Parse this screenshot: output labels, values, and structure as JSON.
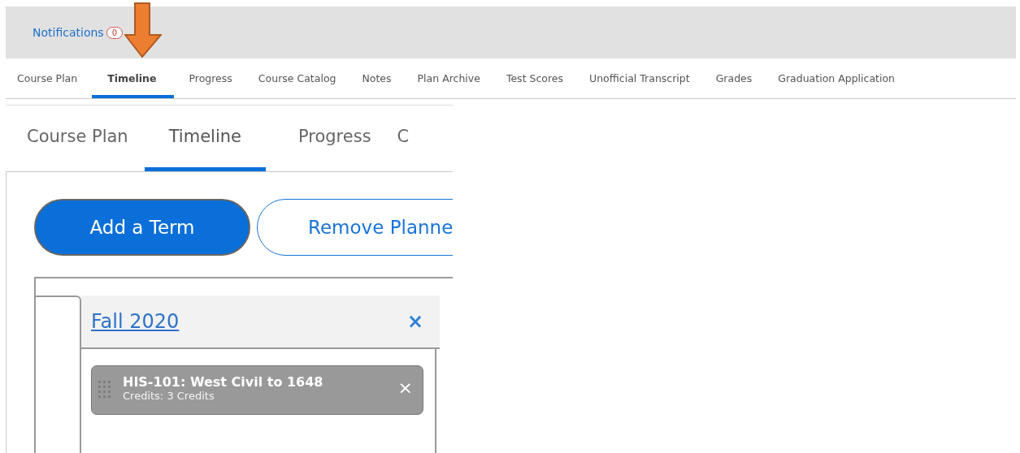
{
  "header": {
    "notifications": {
      "label": "Notifications",
      "count": "0"
    }
  },
  "tabs": [
    {
      "label": "Course Plan",
      "selected": false
    },
    {
      "label": "Timeline",
      "selected": true
    },
    {
      "label": "Progress",
      "selected": false
    },
    {
      "label": "Course Catalog",
      "selected": false
    },
    {
      "label": "Notes",
      "selected": false
    },
    {
      "label": "Plan Archive",
      "selected": false
    },
    {
      "label": "Test Scores",
      "selected": false
    },
    {
      "label": "Unofficial Transcript",
      "selected": false
    },
    {
      "label": "Grades",
      "selected": false
    },
    {
      "label": "Graduation Application",
      "selected": false
    }
  ],
  "zoomed_view": {
    "tabs": [
      {
        "label": "Course Plan",
        "selected": false
      },
      {
        "label": "Timeline",
        "selected": true
      },
      {
        "label": "Progress",
        "selected": false
      },
      {
        "label": "C",
        "selected": false
      }
    ],
    "buttons": [
      {
        "label": "Add a Term",
        "kind": "primary"
      },
      {
        "label": "Remove Planne",
        "kind": "outline"
      }
    ],
    "term": {
      "name": "Fall 2020",
      "close": "×",
      "courses": [
        {
          "title": "HIS-101: West Civil to 1648",
          "credits": "Credits: 3 Credits",
          "remove": "×"
        }
      ]
    }
  }
}
